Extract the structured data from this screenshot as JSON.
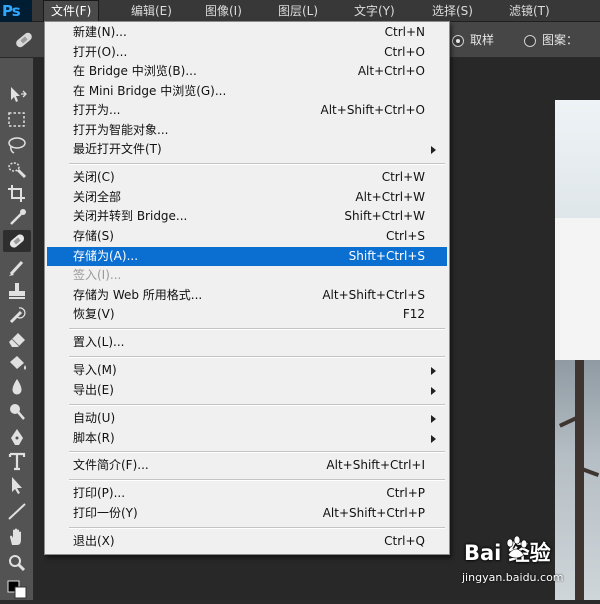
{
  "app": {
    "logo_text": "Ps"
  },
  "menubar": [
    {
      "label": "文件(F)",
      "active": true
    },
    {
      "label": "编辑(E)"
    },
    {
      "label": "图像(I)"
    },
    {
      "label": "图层(L)"
    },
    {
      "label": "文字(Y)"
    },
    {
      "label": "选择(S)"
    },
    {
      "label": "滤镜(T)"
    }
  ],
  "options": {
    "sample_label": "取样",
    "pattern_label": "图案："
  },
  "file_menu": {
    "items": [
      {
        "label": "新建(N)...",
        "shortcut": "Ctrl+N"
      },
      {
        "label": "打开(O)...",
        "shortcut": "Ctrl+O"
      },
      {
        "label": "在 Bridge 中浏览(B)...",
        "shortcut": "Alt+Ctrl+O"
      },
      {
        "label": "在 Mini Bridge 中浏览(G)...",
        "shortcut": ""
      },
      {
        "label": "打开为...",
        "shortcut": "Alt+Shift+Ctrl+O"
      },
      {
        "label": "打开为智能对象...",
        "shortcut": ""
      },
      {
        "label": "最近打开文件(T)",
        "shortcut": "",
        "submenu": true
      },
      {
        "label": "关闭(C)",
        "shortcut": "Ctrl+W"
      },
      {
        "label": "关闭全部",
        "shortcut": "Alt+Ctrl+W"
      },
      {
        "label": "关闭并转到 Bridge...",
        "shortcut": "Shift+Ctrl+W"
      },
      {
        "label": "存储(S)",
        "shortcut": "Ctrl+S"
      },
      {
        "label": "存储为(A)...",
        "shortcut": "Shift+Ctrl+S",
        "highlighted": true
      },
      {
        "label": "签入(I)...",
        "shortcut": "",
        "disabled": true
      },
      {
        "label": "存储为 Web 所用格式...",
        "shortcut": "Alt+Shift+Ctrl+S"
      },
      {
        "label": "恢复(V)",
        "shortcut": "F12"
      },
      {
        "label": "置入(L)...",
        "shortcut": ""
      },
      {
        "label": "导入(M)",
        "shortcut": "",
        "submenu": true
      },
      {
        "label": "导出(E)",
        "shortcut": "",
        "submenu": true
      },
      {
        "label": "自动(U)",
        "shortcut": "",
        "submenu": true
      },
      {
        "label": "脚本(R)",
        "shortcut": "",
        "submenu": true
      },
      {
        "label": "文件简介(F)...",
        "shortcut": "Alt+Shift+Ctrl+I"
      },
      {
        "label": "打印(P)...",
        "shortcut": "Ctrl+P"
      },
      {
        "label": "打印一份(Y)",
        "shortcut": "Alt+Shift+Ctrl+P"
      },
      {
        "label": "退出(X)",
        "shortcut": "Ctrl+Q"
      }
    ]
  },
  "tools": [
    "move-icon",
    "marquee-icon",
    "lasso-icon",
    "quick-select-icon",
    "crop-icon",
    "eyedropper-icon",
    "healing-brush-icon",
    "brush-icon",
    "clone-stamp-icon",
    "history-brush-icon",
    "eraser-icon",
    "paint-bucket-icon",
    "blur-icon",
    "dodge-icon",
    "pen-icon",
    "type-icon",
    "path-select-icon",
    "line-icon",
    "hand-icon",
    "zoom-icon"
  ],
  "watermark": {
    "logo_text": "Bai  经验",
    "url": "jingyan.baidu.com"
  },
  "colors": {
    "highlight": "#0b6fd1",
    "menu_bg": "#f0f0f0",
    "toolbar_bg": "#535353",
    "workspace_bg": "#282828",
    "ps_logo": "#30a8ff"
  }
}
